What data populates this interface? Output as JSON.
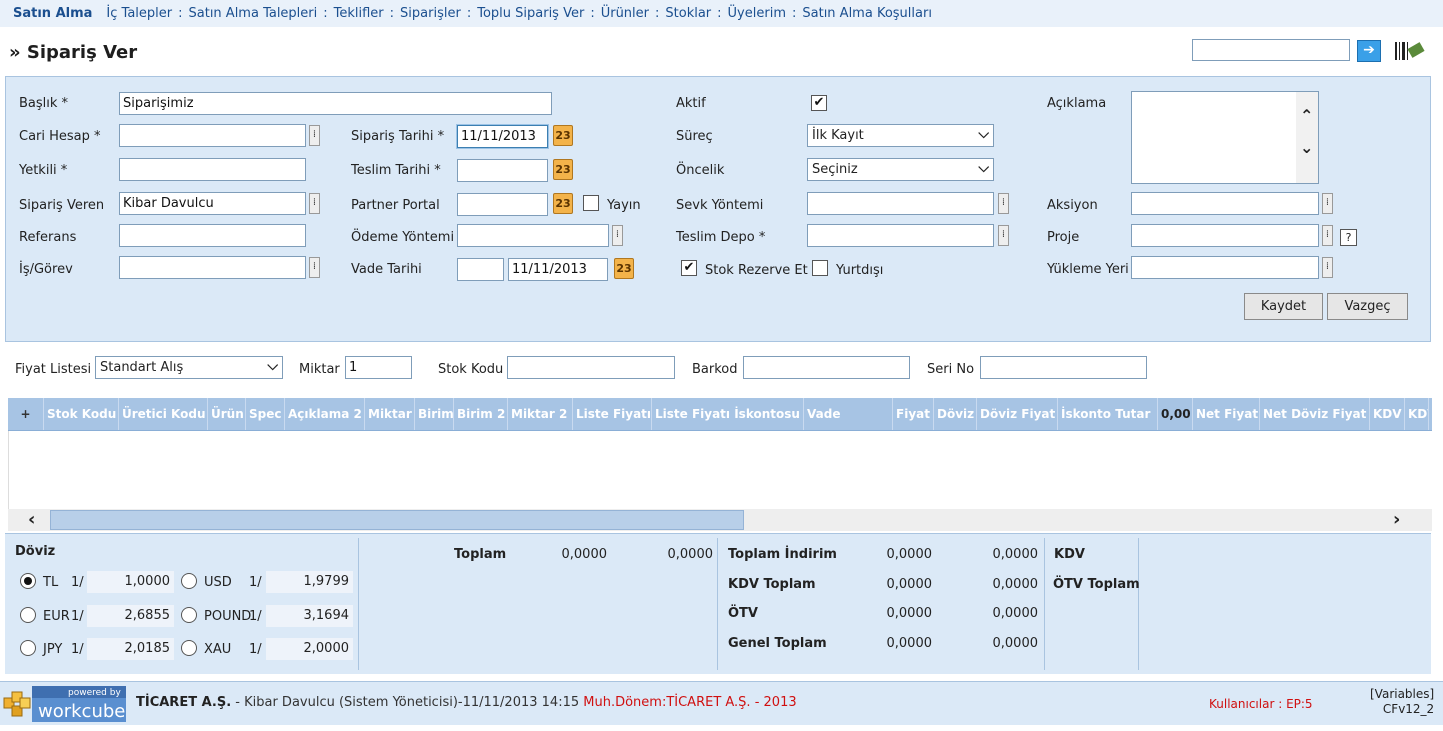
{
  "nav": {
    "brand": "Satın Alma",
    "items": [
      "İç Talepler",
      "Satın Alma Talepleri",
      "Teklifler",
      "Siparişler",
      "Toplu Sipariş Ver",
      "Ürünler",
      "Stoklar",
      "Üyelerim",
      "Satın Alma Koşulları"
    ],
    "separator": ":"
  },
  "page": {
    "title": "» Sipariş Ver",
    "search_value": "",
    "go_icon": "arrow-right-icon",
    "barcode_icon": "barcode-icon"
  },
  "form": {
    "baslik_label": "Başlık *",
    "baslik_value": "Siparişimiz",
    "cari_label": "Cari Hesap *",
    "cari_value": "",
    "yetkili_label": "Yetkili *",
    "yetkili_value": "",
    "siparis_veren_label": "Sipariş Veren",
    "siparis_veren_value": "Kibar Davulcu",
    "referans_label": "Referans",
    "referans_value": "",
    "isgorev_label": "İş/Görev",
    "isgorev_value": "",
    "siparis_tarihi_label": "Sipariş Tarihi *",
    "siparis_tarihi_value": "11/11/2013",
    "teslim_tarihi_label": "Teslim Tarihi *",
    "teslim_tarihi_value": "",
    "partner_label": "Partner Portal",
    "partner_value": "",
    "yayin_label": "Yayın",
    "odeme_label": "Ödeme Yöntemi",
    "odeme_value": "",
    "vade_label": "Vade Tarihi",
    "vade_days": "",
    "vade_value": "11/11/2013",
    "aktif_label": "Aktif",
    "aktif_checked": true,
    "surec_label": "Süreç",
    "surec_value": "İlk Kayıt",
    "oncelik_label": "Öncelik",
    "oncelik_value": "Seçiniz",
    "sevk_label": "Sevk Yöntemi",
    "sevk_value": "",
    "teslim_depo_label": "Teslim Depo *",
    "teslim_depo_value": "",
    "stok_rezerve_label": "Stok Rezerve Et",
    "stok_rezerve_checked": true,
    "yurtdisi_label": "Yurtdışı",
    "yurtdisi_checked": false,
    "aciklama_label": "Açıklama",
    "aciklama_value": "",
    "aksiyon_label": "Aksiyon",
    "aksiyon_value": "",
    "proje_label": "Proje",
    "proje_value": "",
    "yukleme_label": "Yükleme Yeri",
    "yukleme_value": "",
    "cal_text": "23",
    "help_text": "?",
    "save_label": "Kaydet",
    "cancel_label": "Vazgeç"
  },
  "filter": {
    "fiyat_label": "Fiyat Listesi",
    "fiyat_value": "Standart Alış",
    "miktar_label": "Miktar",
    "miktar_value": "1",
    "stok_kodu_label": "Stok Kodu",
    "stok_kodu_value": "",
    "barkod_label": "Barkod",
    "barkod_value": "",
    "seri_label": "Seri No",
    "seri_value": ""
  },
  "grid": {
    "add_symbol": "+",
    "columns": [
      "Stok Kodu",
      "Üretici Kodu",
      "Ürün",
      "Spec",
      "Açıklama 2",
      "Miktar",
      "Birim",
      "Birim 2",
      "Miktar 2",
      "Liste Fiyatı",
      "Liste Fiyatı İskontosu",
      "Vade",
      "Fiyat",
      "Döviz",
      "Döviz Fiyat",
      "İskonto Tutar",
      "0,00",
      "Net Fiyat",
      "Net Döviz Fiyat",
      "KDV",
      "KDV"
    ]
  },
  "totals": {
    "doviz_label": "Döviz",
    "currencies": [
      {
        "name": "TL",
        "unit": "1/",
        "rate": "1,0000",
        "selected": true
      },
      {
        "name": "USD",
        "unit": "1/",
        "rate": "1,9799",
        "selected": false
      },
      {
        "name": "EUR",
        "unit": "1/",
        "rate": "2,6855",
        "selected": false
      },
      {
        "name": "POUND",
        "unit": "1/",
        "rate": "3,1694",
        "selected": false
      },
      {
        "name": "JPY",
        "unit": "1/",
        "rate": "2,0185",
        "selected": false
      },
      {
        "name": "XAU",
        "unit": "1/",
        "rate": "2,0000",
        "selected": false
      }
    ],
    "toplam_label": "Toplam",
    "toplam_1": "0,0000",
    "toplam_2": "0,0000",
    "rows": [
      {
        "label": "Toplam İndirim",
        "v1": "0,0000",
        "v2": "0,0000"
      },
      {
        "label": "KDV Toplam",
        "v1": "0,0000",
        "v2": "0,0000"
      },
      {
        "label": "ÖTV",
        "v1": "0,0000",
        "v2": "0,0000"
      },
      {
        "label": "Genel Toplam",
        "v1": "0,0000",
        "v2": "0,0000"
      }
    ],
    "kdv_label": "KDV",
    "otv_label": "ÖTV Toplam"
  },
  "footer": {
    "logo_powered": "powered by",
    "logo_name": "workcube",
    "company": "TİCARET A.Ş.",
    "session": " - Kibar Davulcu (Sistem Yöneticisi)-11/11/2013 14:15 ",
    "period": "Muh.Dönem:TİCARET A.Ş. - 2013",
    "users": "Kullanıcılar : EP:5",
    "vars": "[Variables]",
    "version": "CFv12_2"
  }
}
